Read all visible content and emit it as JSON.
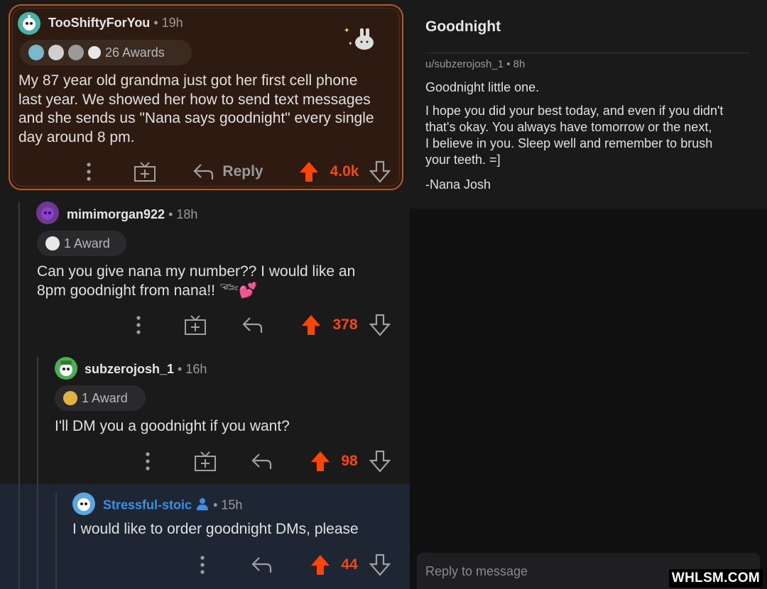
{
  "comments": [
    {
      "username": "TooShiftyForYou",
      "age": " • 19h",
      "awards_label": "26 Awards",
      "body_lines": [
        "My 87 year old grandma just got her first cell phone",
        "last year. We showed her how to send text messages",
        "and she sends us \"Nana says goodnight\" every single",
        "day around 8 pm."
      ],
      "reply_label": "Reply",
      "score": "4.0k"
    },
    {
      "username": "mimimorgan922",
      "age": " • 18h",
      "awards_label": "1 Award",
      "body_lines": [
        "Can you give nana my number?? I would like an",
        "8pm goodnight from nana!! 𓆝💕"
      ],
      "score": "378"
    },
    {
      "username": "subzerojosh_1",
      "age": " • 16h",
      "awards_label": "1 Award",
      "body_lines": [
        "I'll DM you a goodnight if you want?"
      ],
      "score": "98"
    },
    {
      "username": "Stressful-stoic",
      "age": " • 15h",
      "body_lines": [
        "I would like to order goodnight DMs, please"
      ],
      "score": "44"
    }
  ],
  "dm": {
    "title": "Goodnight",
    "meta": "u/subzerojosh_1 • 8h",
    "greeting": "Goodnight little one.",
    "paragraph_lines": [
      "I hope you did your best today, and even if you didn't",
      "that's okay. You always have tomorrow or the next,",
      "I believe in you. Sleep well and remember to brush",
      "your teeth. =]"
    ],
    "signature": "-Nana Josh",
    "reply_placeholder": "Reply to message"
  },
  "watermark": "WHLSM.COM",
  "colors": {
    "upvote": "#ff4500",
    "highlight_border": "#b85a1f",
    "op_name": "#3d8fe0"
  },
  "icons": [
    "more-options-icon",
    "gift-award-icon",
    "reply-arrow-icon",
    "upvote-icon",
    "downvote-icon",
    "user-profile-icon"
  ]
}
